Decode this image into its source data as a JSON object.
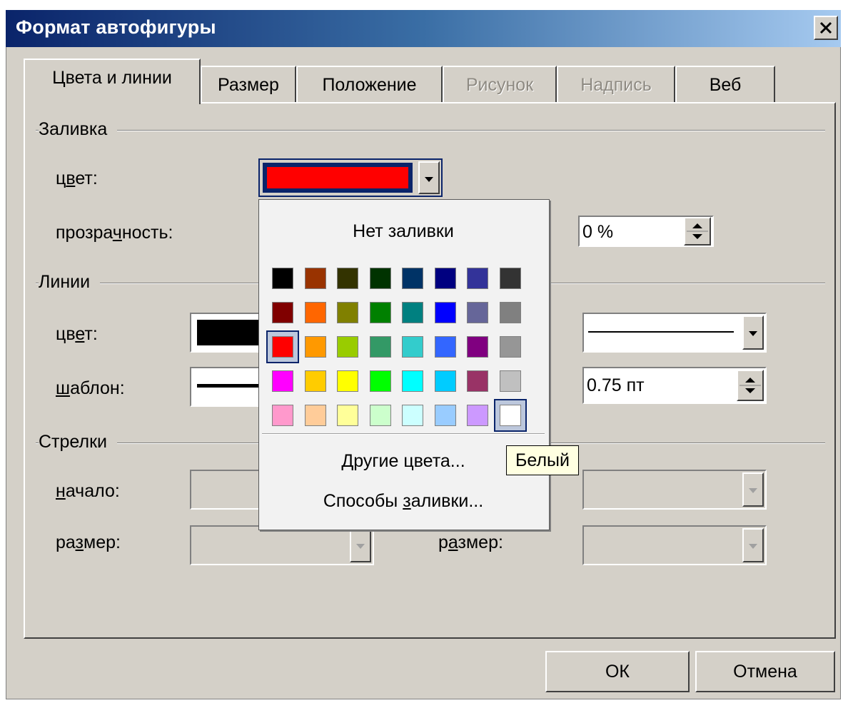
{
  "window": {
    "title": "Формат автофигуры"
  },
  "tabs": [
    {
      "label": "Цвета и линии",
      "active": true,
      "enabled": true
    },
    {
      "label": "Размер",
      "active": false,
      "enabled": true
    },
    {
      "label": "Положение",
      "active": false,
      "enabled": true
    },
    {
      "label": "Рисунок",
      "active": false,
      "enabled": false
    },
    {
      "label": "Надпись",
      "active": false,
      "enabled": false
    },
    {
      "label": "Веб",
      "active": false,
      "enabled": true
    }
  ],
  "fill": {
    "section_label": "Заливка",
    "color_label": "цвет:",
    "color_value": "#ff0000",
    "transparency_label": "прозрачность:",
    "transparency_value": "0 %"
  },
  "lines": {
    "section_label": "Линии",
    "color_label": "цвет:",
    "color_value": "#000000",
    "pattern_label": "шаблон:",
    "weight_value": "0.75 пт"
  },
  "arrows": {
    "section_label": "Стрелки",
    "start_label": "начало:",
    "size_label": "размер:",
    "end_size_label": "размер:"
  },
  "color_popup": {
    "no_fill": "Нет заливки",
    "more_colors": "Другие цвета...",
    "fill_effects": "Способы заливки...",
    "palette": [
      [
        "#000000",
        "#993300",
        "#333300",
        "#003300",
        "#003366",
        "#000080",
        "#333399",
        "#333333"
      ],
      [
        "#800000",
        "#ff6600",
        "#808000",
        "#008000",
        "#008080",
        "#0000ff",
        "#666699",
        "#808080"
      ],
      [
        "#ff0000",
        "#ff9900",
        "#99cc00",
        "#339966",
        "#33cccc",
        "#3366ff",
        "#800080",
        "#969696"
      ],
      [
        "#ff00ff",
        "#ffcc00",
        "#ffff00",
        "#00ff00",
        "#00ffff",
        "#00ccff",
        "#993366",
        "#c0c0c0"
      ],
      [
        "#ff99cc",
        "#ffcc99",
        "#ffff99",
        "#ccffcc",
        "#ccffff",
        "#99ccff",
        "#cc99ff",
        "#ffffff"
      ]
    ],
    "selected": {
      "row": 2,
      "col": 0
    },
    "hovered": {
      "row": 4,
      "col": 7
    },
    "tooltip": "Белый"
  },
  "buttons": {
    "ok": "ОК",
    "cancel": "Отмена"
  }
}
